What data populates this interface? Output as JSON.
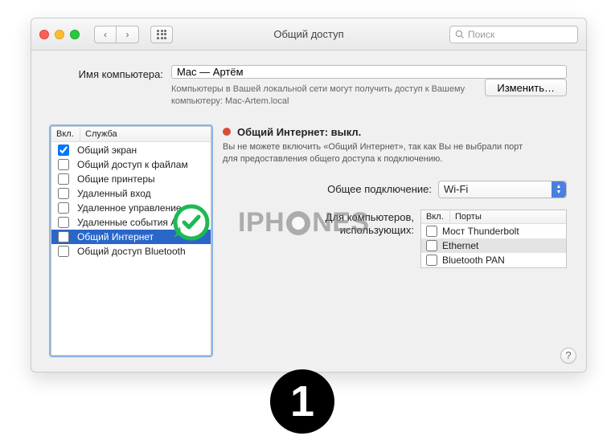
{
  "window": {
    "title": "Общий доступ",
    "search_placeholder": "Поиск"
  },
  "computer": {
    "label": "Имя компьютера:",
    "value": "Mac — Артём",
    "info": "Компьютеры в Вашей локальной сети могут получить доступ к Вашему компьютеру: Mac-Artem.local",
    "edit_label": "Изменить…"
  },
  "services": {
    "col_on": "Вкл.",
    "col_service": "Служба",
    "items": [
      {
        "checked": true,
        "label": "Общий экран",
        "selected": false
      },
      {
        "checked": false,
        "label": "Общий доступ к файлам",
        "selected": false
      },
      {
        "checked": false,
        "label": "Общие принтеры",
        "selected": false
      },
      {
        "checked": false,
        "label": "Удаленный вход",
        "selected": false
      },
      {
        "checked": false,
        "label": "Удаленное управление",
        "selected": false
      },
      {
        "checked": false,
        "label": "Удаленные события Apple",
        "selected": false
      },
      {
        "checked": false,
        "label": "Общий Интернет",
        "selected": true
      },
      {
        "checked": false,
        "label": "Общий доступ Bluetooth",
        "selected": false
      }
    ]
  },
  "detail": {
    "status_title": "Общий Интернет: выкл.",
    "status_desc": "Вы не можете включить «Общий Интернет», так как Вы не выбрали порт для предоставления общего доступа к подключению.",
    "connection_label": "Общее подключение:",
    "connection_value": "Wi-Fi",
    "ports_label": "Для компьютеров, использующих:",
    "ports": {
      "col_on": "Вкл.",
      "col_port": "Порты",
      "items": [
        {
          "checked": false,
          "label": "Мост Thunderbolt",
          "selected": false
        },
        {
          "checked": false,
          "label": "Ethernet",
          "selected": true
        },
        {
          "checked": false,
          "label": "Bluetooth PAN",
          "selected": false
        }
      ]
    }
  },
  "overlay": {
    "watermark": "IPHONES",
    "step_number": "1"
  }
}
